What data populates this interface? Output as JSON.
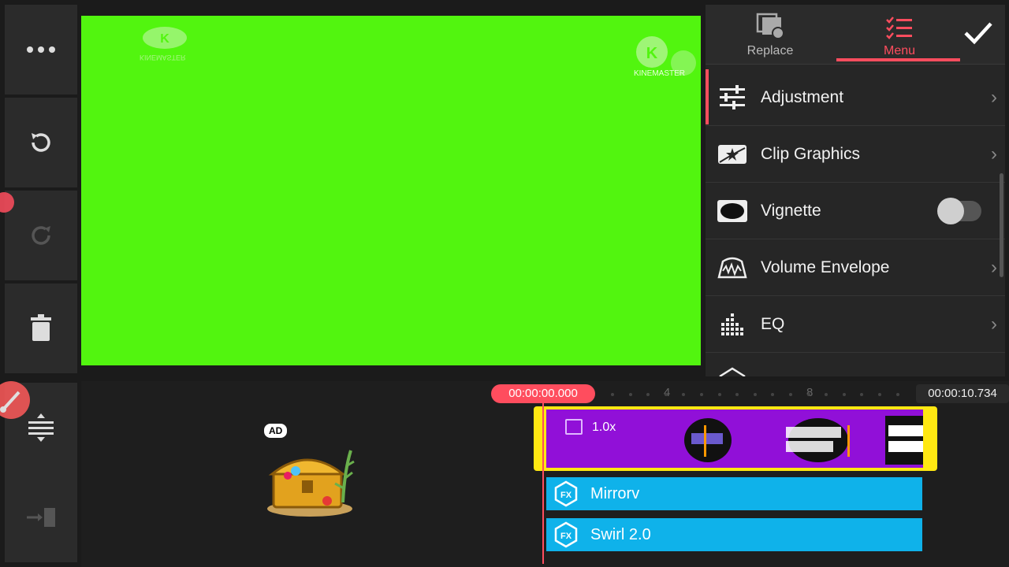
{
  "toolbar": {
    "more_icon": "more-icon",
    "undo_icon": "undo-icon",
    "redo_icon": "redo-icon",
    "delete_icon": "trash-icon",
    "split_icon": "split-icon",
    "export_icon": "export-icon"
  },
  "panel": {
    "tabs": [
      {
        "label": "Replace",
        "icon": "replace-icon",
        "active": false
      },
      {
        "label": "Menu",
        "icon": "menu-icon",
        "active": true
      }
    ],
    "confirm_icon": "check-icon",
    "items": [
      {
        "label": "Adjustment",
        "icon": "adjustment-icon",
        "control": "arrow"
      },
      {
        "label": "Clip Graphics",
        "icon": "clip-graphics-icon",
        "control": "arrow"
      },
      {
        "label": "Vignette",
        "icon": "vignette-icon",
        "control": "toggle",
        "toggle_on": false
      },
      {
        "label": "Volume Envelope",
        "icon": "volume-envelope-icon",
        "control": "arrow"
      },
      {
        "label": "EQ",
        "icon": "eq-icon",
        "control": "arrow"
      }
    ]
  },
  "preview": {
    "background_color": "#52f50f",
    "watermark_text": "KINEMASTER"
  },
  "timeline": {
    "current_time": "00:00:00.000",
    "total_time": "00:00:10.734",
    "ruler_marks": [
      "4",
      "8"
    ],
    "clip": {
      "speed": "1.0x"
    },
    "effects": [
      {
        "label": "Mirrorv",
        "icon": "fx-icon"
      },
      {
        "label": "Swirl 2.0",
        "icon": "fx-icon"
      }
    ],
    "ad_badge": "AD"
  },
  "colors": {
    "accent": "#ff4d5e",
    "clip_border": "#ffe812",
    "clip_fill": "#9110d8",
    "fx_track": "#0fb2ea"
  }
}
